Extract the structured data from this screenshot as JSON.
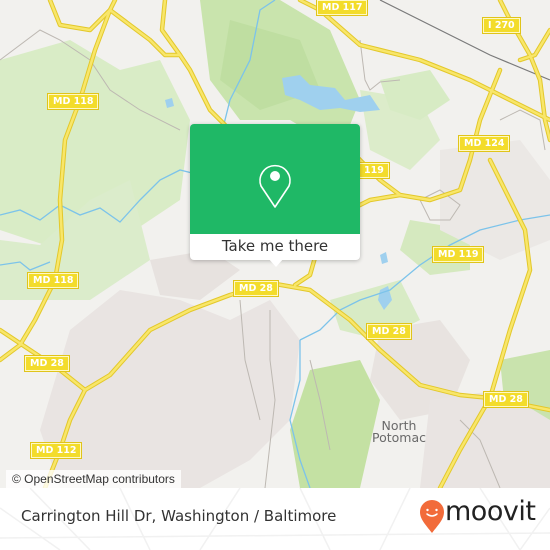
{
  "map": {
    "colors": {
      "background": "#f2f1ee",
      "park": "#d7ebc0",
      "forest": "#c4e3a4",
      "residential": "#e8e3e0",
      "water": "#9fd0ee",
      "river": "#7cc3ea",
      "road_major": "#f3dc2b",
      "road_minor": "#b8b3ad",
      "railway": "#777777"
    },
    "road_labels": [
      {
        "id": "md117",
        "text": "MD 117"
      },
      {
        "id": "i270",
        "text": "I 270"
      },
      {
        "id": "md118-top",
        "text": "MD 118"
      },
      {
        "id": "md118-mid",
        "text": "MD 118"
      },
      {
        "id": "md124",
        "text": "MD 124"
      },
      {
        "id": "md119-top",
        "text": "119"
      },
      {
        "id": "md119-mid",
        "text": "MD 119"
      },
      {
        "id": "md28-center",
        "text": "MD 28"
      },
      {
        "id": "md28-left",
        "text": "MD 28"
      },
      {
        "id": "md28-right",
        "text": "MD 28"
      },
      {
        "id": "md28-far-right",
        "text": "MD 28"
      },
      {
        "id": "md112",
        "text": "MD 112"
      }
    ],
    "place_labels": [
      {
        "id": "north-potomac",
        "line1": "North",
        "line2": "Potomac"
      }
    ],
    "attribution": "© OpenStreetMap contributors"
  },
  "popup": {
    "icon": "map-pin-icon",
    "button_label": "Take me there",
    "accent": "#1fb866"
  },
  "footer": {
    "location_title": "Carrington Hill Dr, Washington / Baltimore",
    "brand": "moovit",
    "brand_color": "#f26b3a"
  }
}
